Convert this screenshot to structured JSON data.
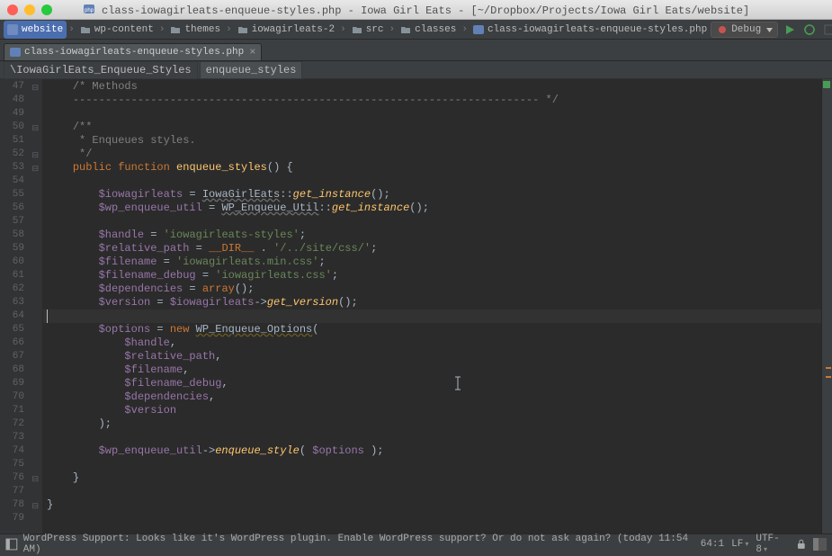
{
  "window": {
    "title_file": "class-iowagirleats-enqueue-styles.php",
    "title_project": "Iowa Girl Eats",
    "title_path": "[~/Dropbox/Projects/Iowa Girl Eats/website]"
  },
  "breadcrumbs": [
    "website",
    "wp-content",
    "themes",
    "iowagirleats-2",
    "src",
    "classes",
    "class-iowagirleats-enqueue-styles.php"
  ],
  "run_config": "Debug",
  "tab": {
    "label": "class-iowagirleats-enqueue-styles.php"
  },
  "symbol_path": {
    "class": "\\IowaGirlEats_Enqueue_Styles",
    "method": "enqueue_styles"
  },
  "gutter": {
    "start": 47,
    "end": 79
  },
  "code": {
    "l47": "/* Methods",
    "l48": "------------------------------------------------------------------------ */",
    "l49": "",
    "l50": "/**",
    "l51": " * Enqueues styles.",
    "l52": " */",
    "l53_pre": "public function",
    "l53_fn": "enqueue_styles",
    "l53_post": "() {",
    "l54": "",
    "l55_v": "$iowagirleats",
    "l55_eq": " = ",
    "l55_cls": "IowaGirlEats",
    "l55_fn": "get_instance",
    "l56_v": "$wp_enqueue_util",
    "l56_cls": "WP_Enqueue_Util",
    "l56_fn": "get_instance",
    "l58_v": "$handle",
    "l58_s": "'iowagirleats-styles'",
    "l59_v": "$relative_path",
    "l59_dir": "__DIR__",
    "l59_s": "'/../site/css/'",
    "l60_v": "$filename",
    "l60_s": "'iowagirleats.min.css'",
    "l61_v": "$filename_debug",
    "l61_s": "'iowagirleats.css'",
    "l62_v": "$dependencies",
    "l62_arr": "array",
    "l63_v": "$version",
    "l63_v2": "$iowagirleats",
    "l63_m": "get_version",
    "l65_v": "$options",
    "l65_new": "new",
    "l65_cls": "WP_Enqueue_Options",
    "l66": "$handle",
    "l67": "$relative_path",
    "l68": "$filename",
    "l69": "$filename_debug",
    "l70": "$dependencies",
    "l71": "$version",
    "l74_v": "$wp_enqueue_util",
    "l74_m": "enqueue_style",
    "l74_arg": "$options"
  },
  "status": {
    "message": "WordPress Support: Looks like it's WordPress plugin. Enable WordPress support? Or do not ask again? (today 11:54 AM)",
    "position": "64:1",
    "line_ending": "LF",
    "encoding": "UTF-8"
  }
}
